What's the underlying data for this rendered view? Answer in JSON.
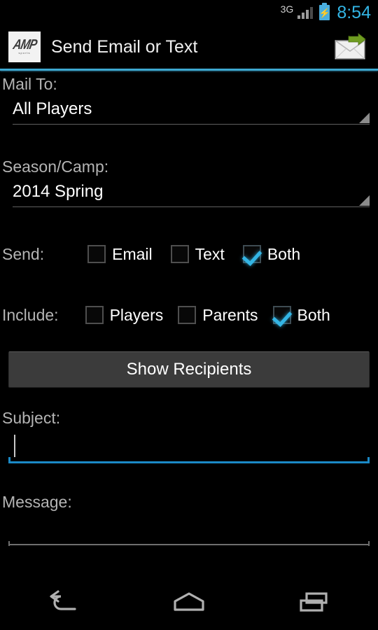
{
  "status_bar": {
    "network_type": "3G",
    "battery_state": "charging",
    "time": "8:54",
    "accent_color": "#33b5e5"
  },
  "action_bar": {
    "logo_text": "AMP",
    "logo_subtext": "sports",
    "title": "Send Email or Text",
    "send_icon": "send-email-icon",
    "divider_color": "#3da8d0"
  },
  "form": {
    "mail_to": {
      "label": "Mail To:",
      "value": "All Players"
    },
    "season_camp": {
      "label": "Season/Camp:",
      "value": "2014 Spring"
    },
    "send": {
      "label": "Send:",
      "options": [
        {
          "label": "Email",
          "checked": false
        },
        {
          "label": "Text",
          "checked": false
        },
        {
          "label": "Both",
          "checked": true
        }
      ]
    },
    "include": {
      "label": "Include:",
      "options": [
        {
          "label": "Players",
          "checked": false
        },
        {
          "label": "Parents",
          "checked": false
        },
        {
          "label": "Both",
          "checked": true
        }
      ]
    },
    "show_recipients_button": "Show Recipients",
    "subject": {
      "label": "Subject:",
      "value": "",
      "placeholder": "",
      "focused": true
    },
    "message": {
      "label": "Message:",
      "value": "",
      "placeholder": "",
      "focused": false
    }
  },
  "nav_bar": {
    "back": "back-icon",
    "home": "home-icon",
    "recents": "recents-icon"
  }
}
